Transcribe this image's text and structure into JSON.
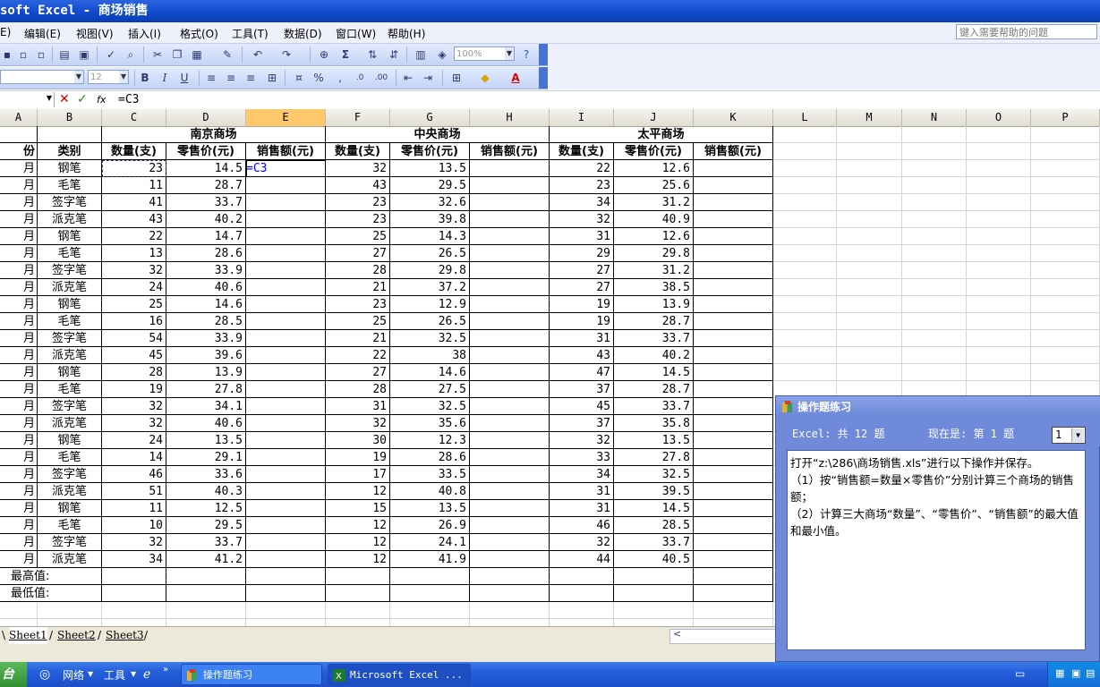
{
  "window": {
    "title": "soft Excel - 商场销售"
  },
  "menu": {
    "items": [
      "E)",
      "编辑(E)",
      "视图(V)",
      "插入(I)",
      "格式(O)",
      "工具(T)",
      "数据(D)",
      "窗口(W)",
      "帮助(H)"
    ],
    "help_placeholder": "键入需要帮助的问题"
  },
  "toolbar": {
    "zoom": "100%",
    "font_size": "12"
  },
  "formula_bar": {
    "formula": "=C3"
  },
  "columns": [
    "A",
    "B",
    "C",
    "D",
    "E",
    "F",
    "G",
    "H",
    "I",
    "J",
    "K",
    "L",
    "M",
    "N",
    "O",
    "P"
  ],
  "selected_column": "E",
  "sheet": {
    "groups": [
      "南京商场",
      "中央商场",
      "太平商场"
    ],
    "headers": [
      "月份",
      "类别",
      "数量(支)",
      "零售价(元)",
      "销售额(元)",
      "数量(支)",
      "零售价(元)",
      "销售额(元)",
      "数量(支)",
      "零售价(元)",
      "销售额(元)"
    ],
    "header_visible": {
      "A": "月份"
    },
    "rows": [
      [
        "一月",
        "钢笔",
        "23",
        "14.5",
        "=C3",
        "32",
        "13.5",
        "",
        "22",
        "12.6",
        ""
      ],
      [
        "一月",
        "毛笔",
        "11",
        "28.7",
        "",
        "43",
        "29.5",
        "",
        "23",
        "25.6",
        ""
      ],
      [
        "一月",
        "签字笔",
        "41",
        "33.7",
        "",
        "23",
        "32.6",
        "",
        "34",
        "31.2",
        ""
      ],
      [
        "一月",
        "派克笔",
        "43",
        "40.2",
        "",
        "23",
        "39.8",
        "",
        "32",
        "40.9",
        ""
      ],
      [
        "二月",
        "钢笔",
        "22",
        "14.7",
        "",
        "25",
        "14.3",
        "",
        "31",
        "12.6",
        ""
      ],
      [
        "二月",
        "毛笔",
        "13",
        "28.6",
        "",
        "27",
        "26.5",
        "",
        "29",
        "29.8",
        ""
      ],
      [
        "二月",
        "签字笔",
        "32",
        "33.9",
        "",
        "28",
        "29.8",
        "",
        "27",
        "31.2",
        ""
      ],
      [
        "二月",
        "派克笔",
        "24",
        "40.6",
        "",
        "21",
        "37.2",
        "",
        "27",
        "38.5",
        ""
      ],
      [
        "三月",
        "钢笔",
        "25",
        "14.6",
        "",
        "23",
        "12.9",
        "",
        "19",
        "13.9",
        ""
      ],
      [
        "三月",
        "毛笔",
        "16",
        "28.5",
        "",
        "25",
        "26.5",
        "",
        "19",
        "28.7",
        ""
      ],
      [
        "三月",
        "签字笔",
        "54",
        "33.9",
        "",
        "21",
        "32.5",
        "",
        "31",
        "33.7",
        ""
      ],
      [
        "三月",
        "派克笔",
        "45",
        "39.6",
        "",
        "22",
        "38",
        "",
        "43",
        "40.2",
        ""
      ],
      [
        "四月",
        "钢笔",
        "28",
        "13.9",
        "",
        "27",
        "14.6",
        "",
        "47",
        "14.5",
        ""
      ],
      [
        "四月",
        "毛笔",
        "19",
        "27.8",
        "",
        "28",
        "27.5",
        "",
        "37",
        "28.7",
        ""
      ],
      [
        "四月",
        "签字笔",
        "32",
        "34.1",
        "",
        "31",
        "32.5",
        "",
        "45",
        "33.7",
        ""
      ],
      [
        "四月",
        "派克笔",
        "32",
        "40.6",
        "",
        "32",
        "35.6",
        "",
        "37",
        "35.8",
        ""
      ],
      [
        "五月",
        "钢笔",
        "24",
        "13.5",
        "",
        "30",
        "12.3",
        "",
        "32",
        "13.5",
        ""
      ],
      [
        "五月",
        "毛笔",
        "14",
        "29.1",
        "",
        "19",
        "28.6",
        "",
        "33",
        "27.8",
        ""
      ],
      [
        "五月",
        "签字笔",
        "46",
        "33.6",
        "",
        "17",
        "33.5",
        "",
        "34",
        "32.5",
        ""
      ],
      [
        "五月",
        "派克笔",
        "51",
        "40.3",
        "",
        "12",
        "40.8",
        "",
        "31",
        "39.5",
        ""
      ],
      [
        "六月",
        "钢笔",
        "11",
        "12.5",
        "",
        "15",
        "13.5",
        "",
        "31",
        "14.5",
        ""
      ],
      [
        "六月",
        "毛笔",
        "10",
        "29.5",
        "",
        "12",
        "26.9",
        "",
        "46",
        "28.5",
        ""
      ],
      [
        "六月",
        "签字笔",
        "32",
        "33.7",
        "",
        "12",
        "24.1",
        "",
        "32",
        "33.7",
        ""
      ],
      [
        "六月",
        "派克笔",
        "34",
        "41.2",
        "",
        "12",
        "41.9",
        "",
        "44",
        "40.5",
        ""
      ]
    ],
    "max_label": "最高值:",
    "min_label": "最低值:"
  },
  "tabs": [
    "Sheet1",
    "Sheet2",
    "Sheet3"
  ],
  "taskbar": {
    "start": "台",
    "network": "网络",
    "tools": "工具",
    "buttons": [
      "操作题练习",
      "Microsoft Excel ..."
    ]
  },
  "pane": {
    "title": "操作题练习",
    "count": "Excel: 共 12 题",
    "current": "现在是: 第 1 题",
    "selected": "1",
    "instructions": [
      "打开“z:\\286\\商场销售.xls”进行以下操作并保存。",
      "（1）按“销售额=数量×零售价”分别计算三个商场的销售额；",
      "（2）计算三大商场“数量”、“零售价”、“销售额”的最大值和最小值。"
    ]
  },
  "colors": {
    "title_bar": "#0f49c8",
    "selected_col": "#ffc86b",
    "pane": "#6f8ad8"
  }
}
